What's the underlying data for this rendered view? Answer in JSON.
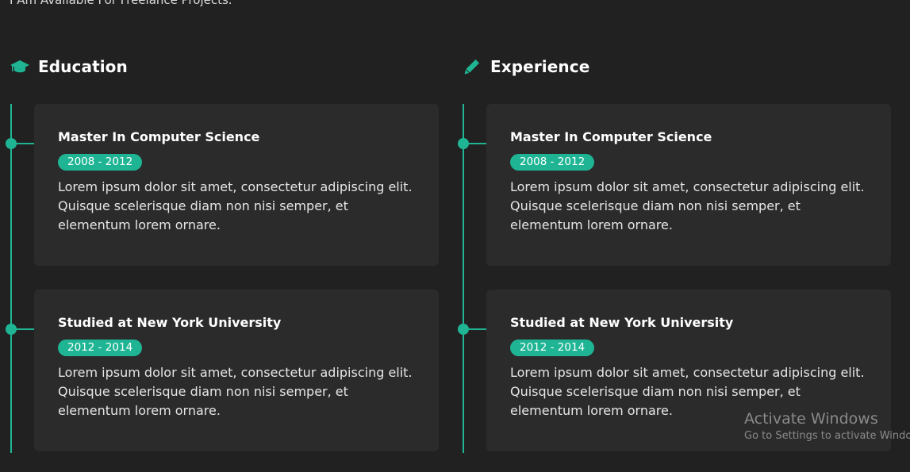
{
  "intro": {
    "text": "I Am Available For Freelance Projects."
  },
  "colors": {
    "accent": "#1fb594",
    "background": "#212121",
    "card": "#2b2b2b"
  },
  "education": {
    "icon": "graduation-cap-icon",
    "title": "Education",
    "items": [
      {
        "title": "Master In Computer Science",
        "years": "2008 - 2012",
        "description": "Lorem ipsum dolor sit amet, consectetur adipiscing elit. Quisque scelerisque diam non nisi semper, et elementum lorem ornare."
      },
      {
        "title": "Studied at New York University",
        "years": "2012 - 2014",
        "description": "Lorem ipsum dolor sit amet, consectetur adipiscing elit. Quisque scelerisque diam non nisi semper, et elementum lorem ornare."
      }
    ]
  },
  "experience": {
    "icon": "pencil-icon",
    "title": "Experience",
    "items": [
      {
        "title": "Master In Computer Science",
        "years": "2008 - 2012",
        "description": "Lorem ipsum dolor sit amet, consectetur adipiscing elit. Quisque scelerisque diam non nisi semper, et elementum lorem ornare."
      },
      {
        "title": "Studied at New York University",
        "years": "2012 - 2014",
        "description": "Lorem ipsum dolor sit amet, consectetur adipiscing elit. Quisque scelerisque diam non nisi semper, et elementum lorem ornare."
      }
    ]
  },
  "watermark": {
    "title": "Activate Windows",
    "subtitle": "Go to Settings to activate Windows."
  }
}
